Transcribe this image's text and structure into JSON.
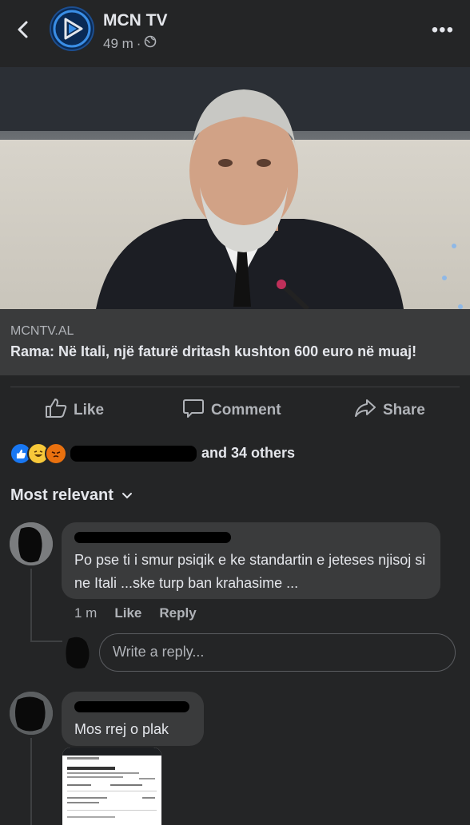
{
  "header": {
    "page_name": "MCN TV",
    "time": "49 m",
    "separator": "·",
    "more_label": "•••"
  },
  "link_preview": {
    "domain": "MCNTV.AL",
    "title": "Rama: Në Itali, një faturë dritash kushton 600 euro në muaj!"
  },
  "actions": {
    "like": "Like",
    "comment": "Comment",
    "share": "Share"
  },
  "reactions": {
    "summary_suffix": "and 34 others"
  },
  "comments_header": {
    "sort_label": "Most relevant"
  },
  "comments": [
    {
      "text": "Po pse ti i smur psiqik e ke standartin e jeteses njisoj si ne Itali ...ske turp ban krahasime ...",
      "time": "1 m",
      "like": "Like",
      "reply": "Reply"
    },
    {
      "text": "Mos rrej o plak"
    }
  ],
  "reply_box": {
    "placeholder": "Write a reply..."
  },
  "colors": {
    "background": "#242526",
    "bubble": "#3a3b3c",
    "secondary_text": "#b0b3b8",
    "like_blue": "#1877f2"
  }
}
